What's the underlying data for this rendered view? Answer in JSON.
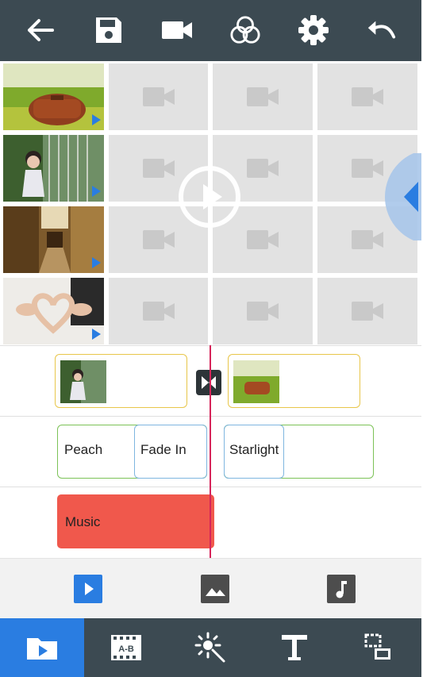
{
  "toolbar": {
    "icons": [
      "back-arrow-icon",
      "save-icon",
      "video-camera-icon",
      "filter-circles-icon",
      "gear-icon",
      "undo-icon"
    ],
    "color": "#3c4a52"
  },
  "media_grid": {
    "rows": 4,
    "columns": 4,
    "placeholder_icon": "video-camera-icon",
    "thumbnails": [
      "brown-bag-on-grass-photo",
      "child-in-garden-photo",
      "old-street-photo",
      "wedding-heart-hands-photo"
    ],
    "center_overlay_icon": "play-circle-icon",
    "side_handle_icon": "chevron-left-icon"
  },
  "timeline": {
    "video_clips": [
      "child-in-garden-photo",
      "brown-bag-on-grass-photo"
    ],
    "transition_icon": "bowtie-transition-icon",
    "effects": {
      "peach": "Peach",
      "fade_in": "Fade In",
      "starlight": "Starlight"
    },
    "music": {
      "label": "Music",
      "color": "#f0584c"
    },
    "playhead_color": "#d6245a"
  },
  "media_tabs": [
    {
      "icon": "video-play-tab-icon",
      "active": true
    },
    {
      "icon": "image-icon",
      "active": false
    },
    {
      "icon": "music-note-icon",
      "active": false
    }
  ],
  "bottom_nav": {
    "items": [
      "folder-play-icon",
      "transition-ab-icon",
      "effects-sparkle-icon",
      "text-icon",
      "layout-icon"
    ],
    "active_index": 0,
    "active_color": "#2a7de1"
  }
}
